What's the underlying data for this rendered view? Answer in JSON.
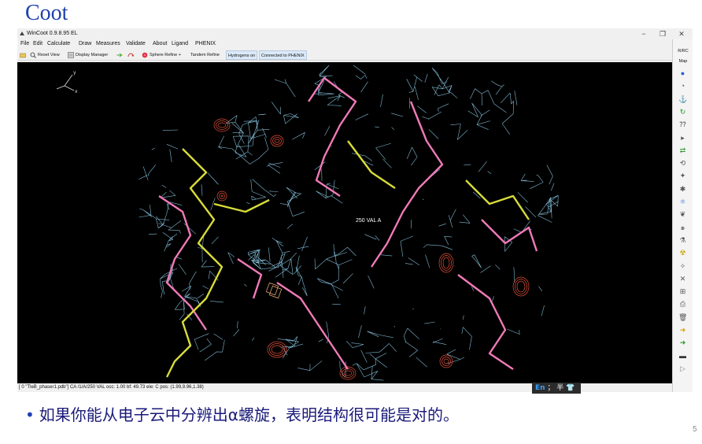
{
  "slide": {
    "title": "Coot",
    "bullet": "如果你能从电子云中分辨出α螺旋，表明结构很可能是对的。",
    "page_number": "5"
  },
  "window": {
    "title": "WinCoot 0.9.8.95 EL",
    "controls": {
      "minimize": "−",
      "restore": "❐",
      "close": "✕"
    }
  },
  "menubar": {
    "items": [
      "File",
      "Edit",
      "Calculate",
      "Draw",
      "Measures",
      "Validate",
      "About",
      "Ligand",
      "PHENIX"
    ]
  },
  "toolbar": {
    "reset_view": "Reset View",
    "display_manager": "Display Manager",
    "sphere_refine": "Sphere Refine +",
    "tandem_refine": "Tandem Refine",
    "hydrogens_on": "Hydrogens on",
    "connected": "Connected to PHENIX"
  },
  "viewport": {
    "axis_y": "y",
    "axis_x": "x",
    "atom_label": "250 VAL A",
    "colors": {
      "map": "#8fd0ee",
      "diff_map": "#e0503a",
      "trace_pink": "#f07ab8",
      "trace_yellow": "#d8dc3a",
      "background": "#000000"
    }
  },
  "statusbar": {
    "text": "[ 0 \"TleB_phaser1.pdb\"]  CA /1/A/250 VAL occ: 1.00 bf: 49.73 ele:  C pos: (1.99,9.96,1.38)"
  },
  "right_panel": {
    "label_top": "R/RC",
    "label_map": "Map",
    "icons": [
      "blue-sphere",
      "clock",
      "anchor",
      "rotate-green",
      "question-arrow",
      "small-arrow",
      "green-flip",
      "refresh",
      "pin",
      "molecule",
      "blue-atom",
      "leaf",
      "swirl",
      "flask",
      "radiation",
      "wand",
      "pen-x",
      "plus-box",
      "printer",
      "trash",
      "arrow-yellow",
      "arrow-green",
      "minus-bar",
      "play"
    ]
  },
  "ime": {
    "mode": "En",
    "extra": "； 半 👕"
  }
}
